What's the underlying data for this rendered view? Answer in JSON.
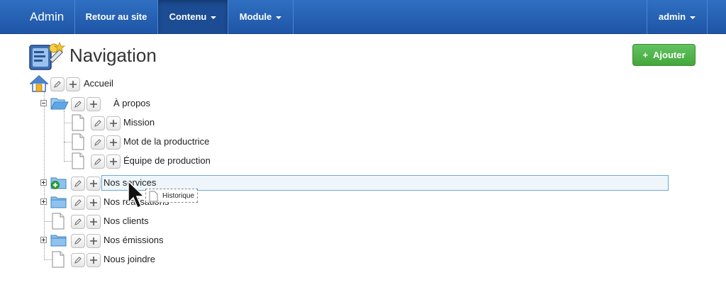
{
  "navbar": {
    "brand": "Admin",
    "links": [
      {
        "label": "Retour au site"
      },
      {
        "label": "Contenu"
      },
      {
        "label": "Module"
      }
    ],
    "user": "admin"
  },
  "header": {
    "title": "Navigation",
    "add_button": "Ajouter"
  },
  "tree": {
    "root": "Accueil",
    "items": [
      {
        "label": "À propos",
        "type": "folder-open"
      },
      {
        "label": "Mission",
        "type": "page"
      },
      {
        "label": "Mot de la productrice",
        "type": "page"
      },
      {
        "label": "Équipe de production",
        "type": "page"
      },
      {
        "label": "Nos services",
        "type": "folder"
      },
      {
        "label": "Nos réalisations",
        "type": "folder"
      },
      {
        "label": "Nos clients",
        "type": "page"
      },
      {
        "label": "Nos émissions",
        "type": "folder"
      },
      {
        "label": "Nous joindre",
        "type": "page"
      }
    ]
  },
  "drag": {
    "label": "Historique"
  },
  "colors": {
    "navbar": "#2f6fc2",
    "add_button": "#51a351",
    "selection": "#eef6fc"
  }
}
